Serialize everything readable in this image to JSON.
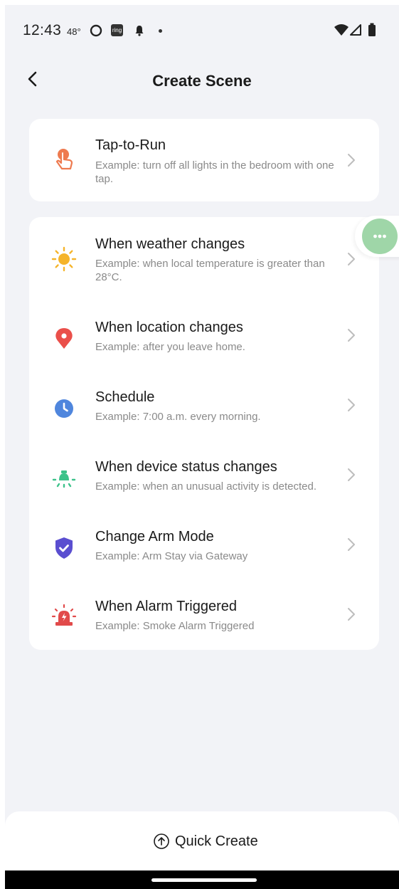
{
  "status_bar": {
    "time": "12:43",
    "temperature": "48°",
    "ring_label": "ring"
  },
  "header": {
    "title": "Create Scene"
  },
  "tap_to_run": {
    "title": "Tap-to-Run",
    "description": "Example: turn off all lights in the bedroom with one tap.",
    "icon": "hand-tap-icon",
    "icon_color": "#ee7a4f"
  },
  "automation_items": [
    {
      "title": "When weather changes",
      "description": "Example: when local temperature is greater than 28°C.",
      "icon": "sun-icon",
      "icon_color": "#f5b42a"
    },
    {
      "title": "When location changes",
      "description": "Example: after you leave home.",
      "icon": "location-pin-icon",
      "icon_color": "#ea4f4a"
    },
    {
      "title": "Schedule",
      "description": "Example: 7:00 a.m. every morning.",
      "icon": "clock-icon",
      "icon_color": "#4f86dd"
    },
    {
      "title": "When device status changes",
      "description": "Example: when an unusual activity is detected.",
      "icon": "device-bulb-icon",
      "icon_color": "#3cc28a"
    },
    {
      "title": "Change Arm Mode",
      "description": "Example: Arm Stay via Gateway",
      "icon": "shield-check-icon",
      "icon_color": "#5a4ed0"
    },
    {
      "title": "When Alarm Triggered",
      "description": "Example: Smoke Alarm Triggered",
      "icon": "siren-icon",
      "icon_color": "#e14a4a"
    }
  ],
  "quick_create": {
    "label": "Quick Create"
  },
  "colors": {
    "background": "#f2f3f7",
    "card": "#ffffff",
    "float_button": "#9fd6a8",
    "chevron": "#bdbdbd"
  }
}
